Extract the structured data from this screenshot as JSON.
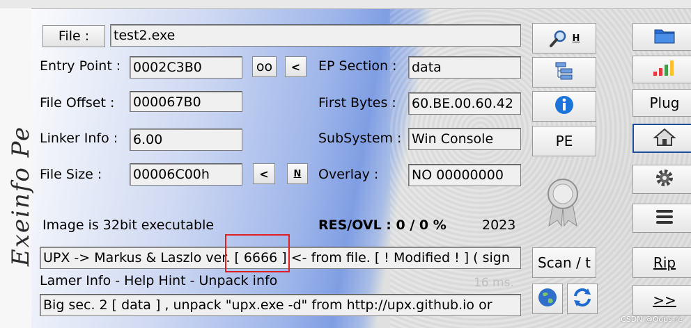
{
  "left_column": {
    "file_button": "File :",
    "file_path": "test2.exe",
    "entry_point_label": "Entry Point :",
    "entry_point_value": "0002C3B0",
    "oo_button": "oo",
    "lt_button": "<",
    "file_offset_label": "File Offset :",
    "file_offset_value": "000067B0",
    "linker_label": "Linker Info :",
    "linker_value": "6.00",
    "file_size_label": "File Size :",
    "file_size_value": "00006C00h",
    "size_lt_button": "<",
    "size_n_button": "N",
    "image_info": "Image is 32bit executable"
  },
  "right_fields": {
    "ep_section_label": "EP Section :",
    "ep_section_value": "data",
    "first_bytes_label": "First Bytes :",
    "first_bytes_value": "60.BE.00.60.42",
    "subsystem_label": "SubSystem :",
    "subsystem_value": "Win Console",
    "overlay_label": "Overlay :",
    "overlay_value": "NO   00000000",
    "res_ovl": "RES/OVL : 0 / 0 %",
    "year": "2023"
  },
  "detect": {
    "signature_text": "UPX -> Markus & Laszlo ver. [ 6666 ] <- from file. [ ! Modified ! ] ( sign",
    "lamer_info": "Lamer Info - Help Hint - Unpack info",
    "time_text": "16 ms.",
    "hint_text": "Big sec. 2 [ data ] , unpack \"upx.exe -d\"  from  http://upx.github.io or"
  },
  "tool_buttons": {
    "search_h": "H",
    "pe_label": "PE",
    "scan_label": "Scan / t",
    "plug_label": "Plug",
    "rip_label": "Rip",
    "next_label": ">>"
  },
  "watermark": "CSDN @Oops-re",
  "signature_art": "Exeinfo Pe",
  "colors": {
    "accent": "#1f5fbf",
    "highlight": "#e02020",
    "field_bg": "#f0f0f0"
  }
}
